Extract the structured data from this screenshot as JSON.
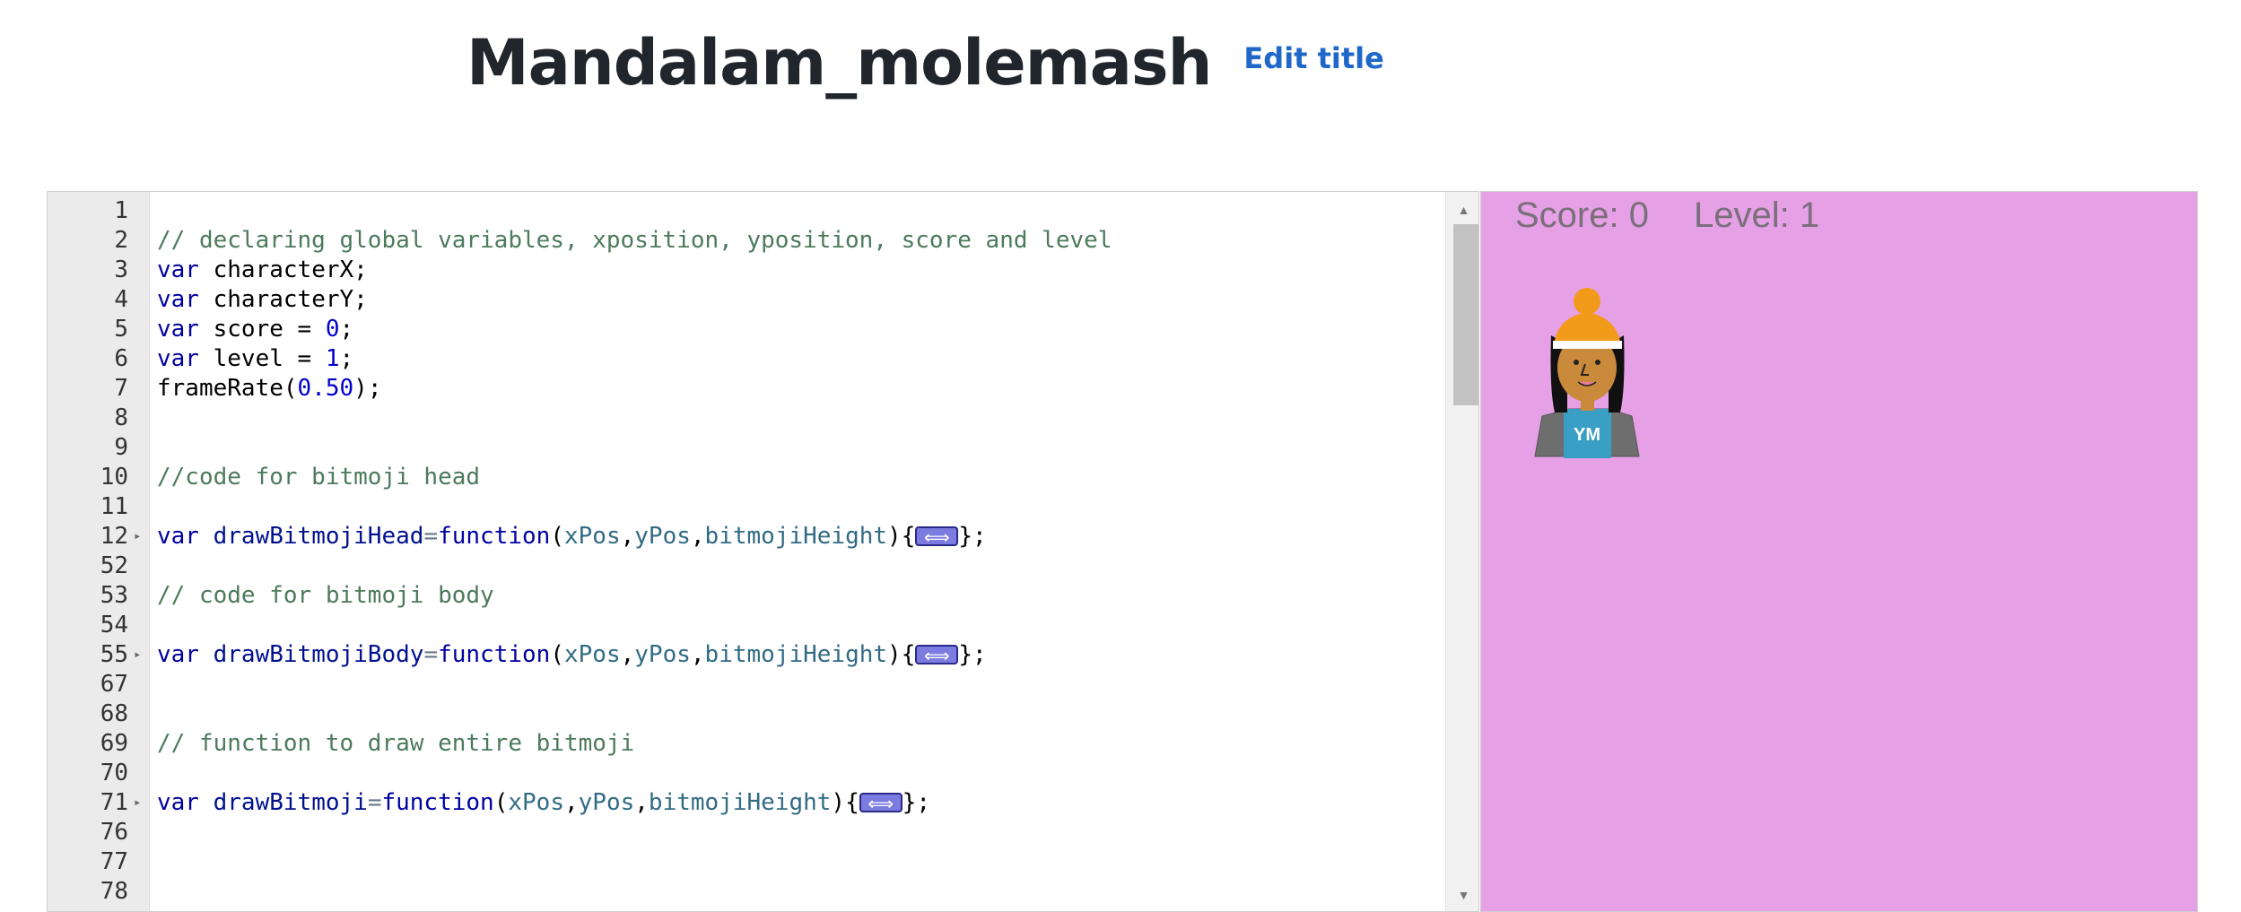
{
  "header": {
    "title": "Mandalam_molemash",
    "edit_label": "Edit title"
  },
  "editor": {
    "lines": [
      {
        "n": "1"
      },
      {
        "n": "2",
        "comment": "// declaring global variables, xposition, yposition, score and level"
      },
      {
        "n": "3",
        "kw": "var",
        "text": " characterX;"
      },
      {
        "n": "4",
        "kw": "var",
        "text": " characterY;"
      },
      {
        "n": "5",
        "kw": "var",
        "text": " score = ",
        "num": "0",
        "end": ";"
      },
      {
        "n": "6",
        "kw": "var",
        "text": " level = ",
        "num": "1",
        "end": ";"
      },
      {
        "n": "7",
        "text": "frameRate(",
        "num": "0.50",
        "end": ");"
      },
      {
        "n": "8"
      },
      {
        "n": "9"
      },
      {
        "n": "10",
        "comment": "//code for bitmoji head"
      },
      {
        "n": "11"
      },
      {
        "n": "12",
        "fold": true,
        "kw": "var",
        "name": "drawBitmojiHead",
        "params": [
          "xPos",
          "yPos",
          "bitmojiHeight"
        ]
      },
      {
        "n": "52"
      },
      {
        "n": "53",
        "comment": "// code for bitmoji body"
      },
      {
        "n": "54"
      },
      {
        "n": "55",
        "fold": true,
        "kw": "var",
        "name": "drawBitmojiBody",
        "params": [
          "xPos",
          "yPos",
          "bitmojiHeight"
        ]
      },
      {
        "n": "67"
      },
      {
        "n": "68"
      },
      {
        "n": "69",
        "comment": "// function to draw entire bitmoji"
      },
      {
        "n": "70"
      },
      {
        "n": "71",
        "fold": true,
        "kw": "var",
        "name": "drawBitmoji",
        "params": [
          "xPos",
          "yPos",
          "bitmojiHeight"
        ]
      },
      {
        "n": "76"
      },
      {
        "n": "77"
      },
      {
        "n": "78"
      }
    ],
    "keyword_function": "function"
  },
  "canvas": {
    "background": "#e6a0e6",
    "score_label": "Score: 0",
    "level_label": "Level: 1",
    "bitmoji_initials": "YM"
  },
  "colors": {
    "accent": "#1f68c9",
    "title": "#21252c"
  }
}
